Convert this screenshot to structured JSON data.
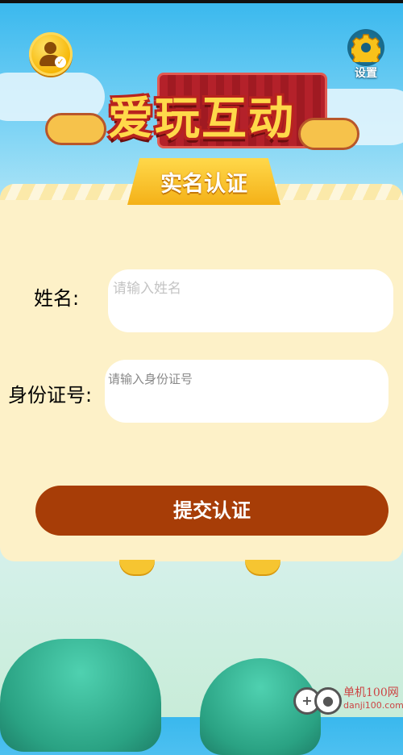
{
  "header": {
    "settings_label": "设置"
  },
  "logo": {
    "title": "爱玩互动"
  },
  "form": {
    "heading": "实名认证",
    "name_label": "姓名:",
    "name_placeholder": "请输入姓名",
    "id_label": "身份证号:",
    "id_placeholder": "请输入身份证号",
    "submit_label": "提交认证"
  },
  "watermark": {
    "brand": "单机100网",
    "domain": "danji100.com"
  },
  "colors": {
    "sky": "#39b8ee",
    "card": "#fdf1c8",
    "ribbon": "#ffd84a",
    "submit": "#a73d07",
    "logo_text": "#ffd94a",
    "logo_outline": "#b8231e"
  }
}
